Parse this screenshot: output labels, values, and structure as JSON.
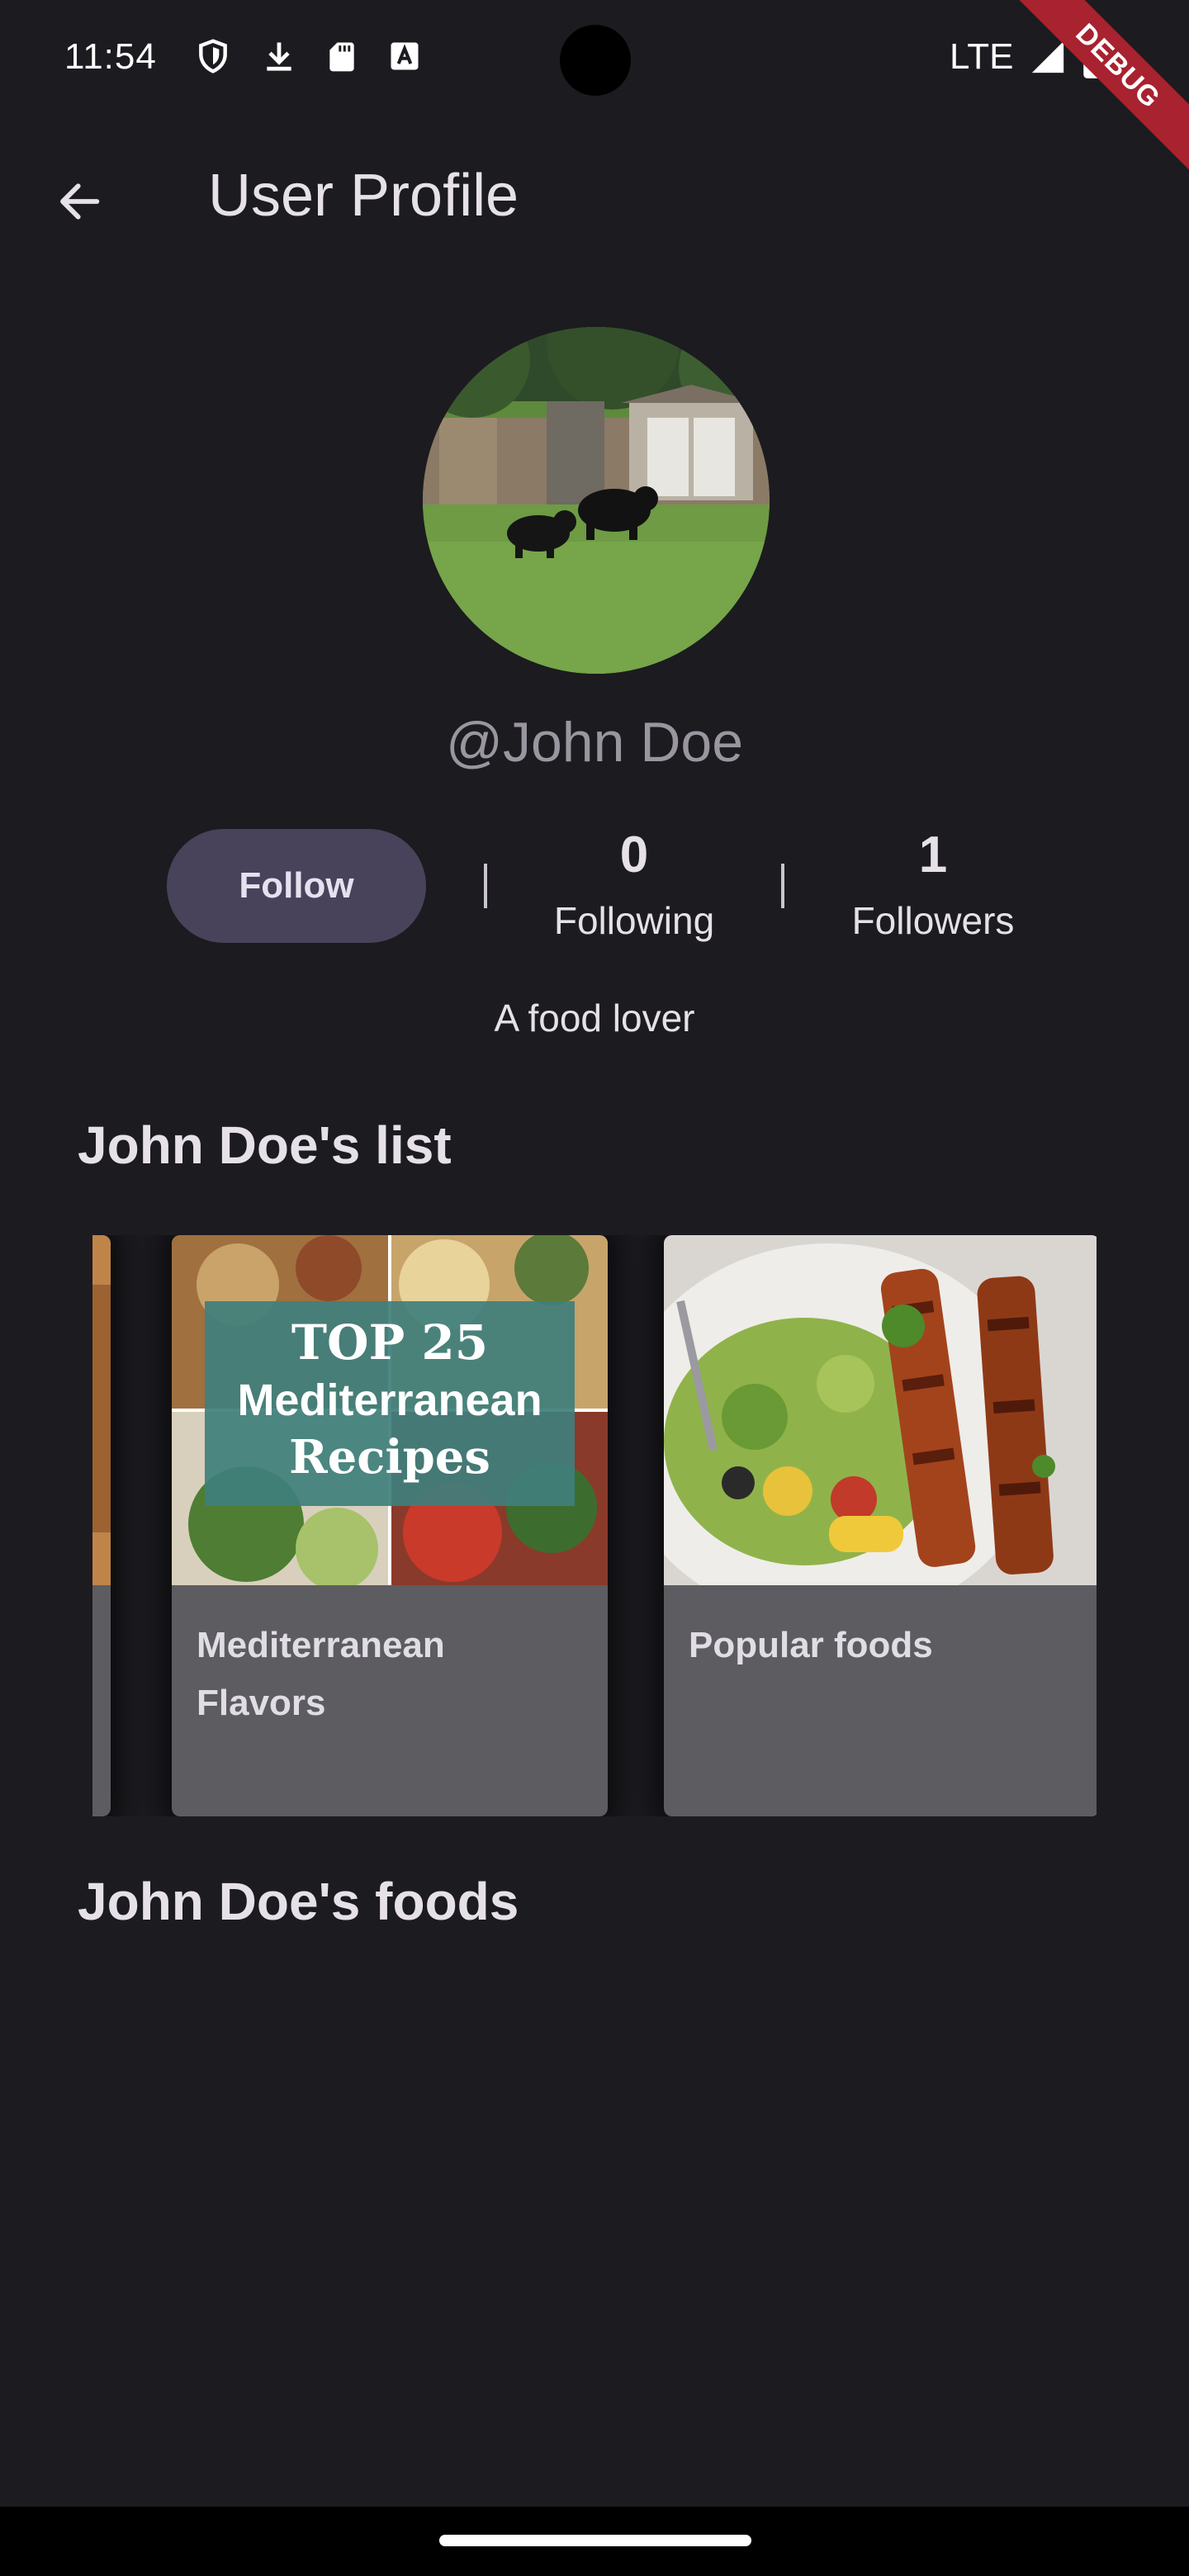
{
  "status_bar": {
    "time": "11:54",
    "network": "LTE",
    "icons": [
      "shield-icon",
      "download-icon",
      "sd-card-icon",
      "font-icon",
      "signal-icon",
      "battery-icon"
    ]
  },
  "debug_banner": {
    "label": "DEBUG"
  },
  "app_bar": {
    "title": "User Profile"
  },
  "profile": {
    "username": "@John Doe",
    "follow_label": "Follow",
    "following_count": "0",
    "following_label": "Following",
    "followers_count": "1",
    "followers_label": "Followers",
    "bio": "A food lover"
  },
  "lists_section": {
    "title": "John Doe's list",
    "cards": [
      {
        "title": "Mediterranean Flavors",
        "image_text": [
          "TOP 25",
          "Mediterranean",
          "Recipes"
        ]
      },
      {
        "title": "Popular foods"
      }
    ]
  },
  "foods_section": {
    "title": "John Doe's foods"
  },
  "colors": {
    "background": "#1c1b20",
    "follow_button": "#48435a",
    "card_background": "#5d5c61",
    "debug_ribbon": "#a8222f"
  }
}
